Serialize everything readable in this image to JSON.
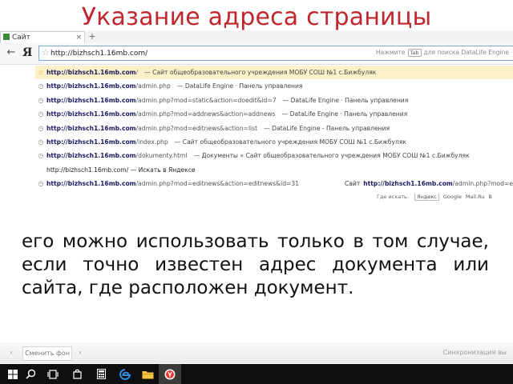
{
  "slide": {
    "title": "Указание адреса страницы",
    "body": "его можно использовать только в том случае, если точно известен адрес документа или сайта, где расположен документ."
  },
  "browser": {
    "tab_title": "Сайт общеобразовательн",
    "tab_close": "×",
    "new_tab": "+",
    "yandex_logo": "Я",
    "address_value": "http://bizhsch1.16mb.com/",
    "hint": {
      "before": "Нажмите",
      "key": "Tab",
      "after": "для поиска DataLife Engine"
    },
    "suggestions": [
      {
        "icon": "star-icon",
        "host": "http://bizhsch1.16mb.com",
        "path": "/",
        "desc": "— Сайт общеобразовательного учреждения МОБУ СОШ №1 с.Бижбуляк",
        "selected": true
      },
      {
        "icon": "history-icon",
        "host": "http://bizhsch1.16mb.com",
        "path": "/admin.php",
        "desc": "— DataLife Engine · Панель управления",
        "selected": false
      },
      {
        "icon": "history-icon",
        "host": "http://bizhsch1.16mb.com",
        "path": "/admin.php?mod=static&action=doedit&id=7",
        "desc": "— DataLife Engine · Панель управления",
        "selected": false
      },
      {
        "icon": "history-icon",
        "host": "http://bizhsch1.16mb.com",
        "path": "/admin.php?mod=addnews&action=addnews",
        "desc": "— DataLife Engine · Панель управления",
        "selected": false
      },
      {
        "icon": "history-icon",
        "host": "http://bizhsch1.16mb.com",
        "path": "/admin.php?mod=editnews&action=list",
        "desc": "— DataLife Engine - Панель управления",
        "selected": false
      },
      {
        "icon": "history-icon",
        "host": "http://bizhsch1.16mb.com",
        "path": "/index.php",
        "desc": "— Сайт общеобразовательного учреждения МОБУ СОШ №1 с.Бижбуляк",
        "selected": false
      },
      {
        "icon": "history-icon",
        "host": "http://bizhsch1.16mb.com",
        "path": "/dokumenty.html",
        "desc": "— Документы » Сайт общеобразовательного учреждения МОБУ СОШ №1 с.Бижбуляк",
        "selected": false
      },
      {
        "icon": "",
        "plain": "http://bizhsch1.16mb.com/ — Искать в Яндексе"
      },
      {
        "icon": "history-icon",
        "host": "http://bizhsch1.16mb.com",
        "path": "/admin.php?mod=editnews&action=editnews&id=31",
        "desc": "",
        "site_label": "Сайт",
        "site_host": "http://bizhsch1.16mb.com",
        "site_path": "/admin.php?mod=e",
        "selected": false
      }
    ],
    "search_with": {
      "label": "Где искать:",
      "engines": [
        "Яндекс",
        "Google",
        "Mail.Ru",
        "B"
      ]
    }
  },
  "slideshow": {
    "prev": "‹",
    "change_bg": "Сменить фон",
    "next": "›",
    "right_label": "Синхронизация вы"
  },
  "taskbar": {
    "items": [
      "windows-start-icon",
      "search-icon",
      "task-view-icon",
      "store-icon",
      "calculator-icon",
      "edge-icon",
      "file-explorer-icon",
      "yandex-browser-icon"
    ],
    "active_index": 7
  },
  "colors": {
    "title": "#c0272d",
    "selected_row": "#fdf1c9",
    "taskbar": "#0f0f0f"
  }
}
